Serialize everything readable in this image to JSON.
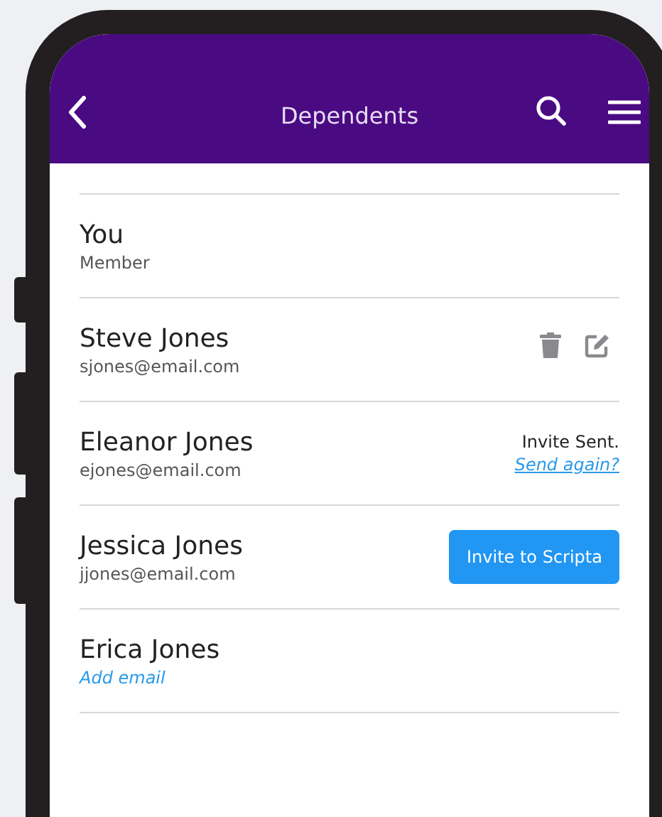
{
  "header": {
    "title": "Dependents"
  },
  "dependents": [
    {
      "kind": "member",
      "name": "You",
      "detail": "Member"
    },
    {
      "kind": "actions",
      "name": "Steve Jones",
      "detail": "sjones@email.com"
    },
    {
      "kind": "invited",
      "name": "Eleanor Jones",
      "detail": "ejones@email.com",
      "status": "Invite Sent.",
      "link": "Send again?"
    },
    {
      "kind": "invite",
      "name": "Jessica Jones",
      "detail": "jjones@email.com",
      "button": "Invite to Scripta"
    },
    {
      "kind": "add_email",
      "name": "Erica Jones",
      "link": "Add email"
    }
  ]
}
